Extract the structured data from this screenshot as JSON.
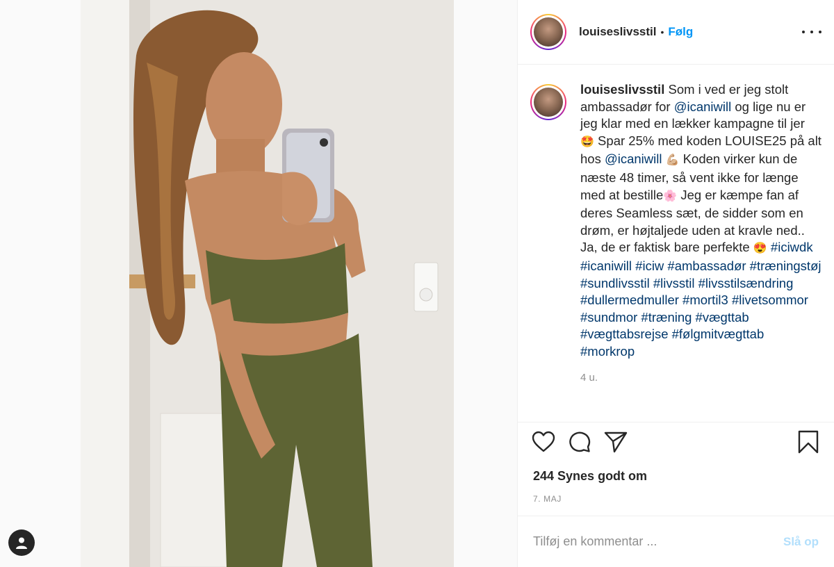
{
  "post": {
    "author": "louiseslivsstil",
    "separator": "•",
    "follow_label": "Følg",
    "more_icon": "more-options-icon"
  },
  "caption": {
    "username": "louiseslivsstil",
    "t1": "Som i ved er jeg stolt ambassadør for ",
    "mention1": "@icaniwill",
    "t2": " og lige nu er jeg klar med en lækker kampagne til jer ",
    "emoji1": "🤩",
    "t3": " Spar 25% med koden LOUISE25 på alt hos ",
    "mention2": "@icaniwill",
    "emoji2": "💪🏼",
    "t4": " Koden virker kun de næste 48 timer, så vent ikke for længe med at bestille",
    "emoji3": "🌸",
    "t5": " Jeg er kæmpe fan af deres Seamless sæt, de sidder som en drøm, er højtaljede uden at kravle ned.. Ja, de er faktisk bare perfekte ",
    "emoji4": "😍",
    "hashtags": "#iciwdk #icaniwill #iciw #ambassadør #træningstøj #sundlivsstil #livsstil #livsstilsændring #dullermedmuller #mortil3 #livetsommor #sundmor #træning #vægttab #vægttabsrejse #følgmitvægttab #morkrop",
    "time_ago": "4 u."
  },
  "actions": {
    "like_icon": "heart-icon",
    "comment_icon": "comment-icon",
    "share_icon": "share-icon",
    "save_icon": "bookmark-icon"
  },
  "likes_text": "244 Synes godt om",
  "date_text": "7. MAJ",
  "comment_box": {
    "placeholder": "Tilføj en kommentar ...",
    "post_label": "Slå op"
  },
  "colors": {
    "follow": "#0095f6",
    "hashtag": "#00376b",
    "post_disabled": "#b2dffc",
    "muted": "#8e8e8e"
  }
}
